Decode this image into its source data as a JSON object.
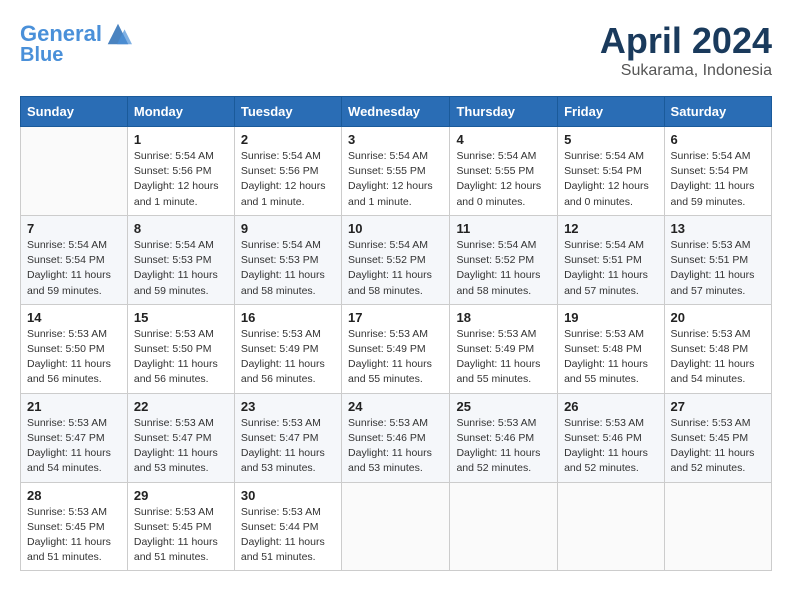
{
  "header": {
    "logo_line1": "General",
    "logo_line2": "Blue",
    "month": "April 2024",
    "location": "Sukarama, Indonesia"
  },
  "weekdays": [
    "Sunday",
    "Monday",
    "Tuesday",
    "Wednesday",
    "Thursday",
    "Friday",
    "Saturday"
  ],
  "weeks": [
    [
      {
        "day": "",
        "info": ""
      },
      {
        "day": "1",
        "info": "Sunrise: 5:54 AM\nSunset: 5:56 PM\nDaylight: 12 hours\nand 1 minute."
      },
      {
        "day": "2",
        "info": "Sunrise: 5:54 AM\nSunset: 5:56 PM\nDaylight: 12 hours\nand 1 minute."
      },
      {
        "day": "3",
        "info": "Sunrise: 5:54 AM\nSunset: 5:55 PM\nDaylight: 12 hours\nand 1 minute."
      },
      {
        "day": "4",
        "info": "Sunrise: 5:54 AM\nSunset: 5:55 PM\nDaylight: 12 hours\nand 0 minutes."
      },
      {
        "day": "5",
        "info": "Sunrise: 5:54 AM\nSunset: 5:54 PM\nDaylight: 12 hours\nand 0 minutes."
      },
      {
        "day": "6",
        "info": "Sunrise: 5:54 AM\nSunset: 5:54 PM\nDaylight: 11 hours\nand 59 minutes."
      }
    ],
    [
      {
        "day": "7",
        "info": "Sunrise: 5:54 AM\nSunset: 5:54 PM\nDaylight: 11 hours\nand 59 minutes."
      },
      {
        "day": "8",
        "info": "Sunrise: 5:54 AM\nSunset: 5:53 PM\nDaylight: 11 hours\nand 59 minutes."
      },
      {
        "day": "9",
        "info": "Sunrise: 5:54 AM\nSunset: 5:53 PM\nDaylight: 11 hours\nand 58 minutes."
      },
      {
        "day": "10",
        "info": "Sunrise: 5:54 AM\nSunset: 5:52 PM\nDaylight: 11 hours\nand 58 minutes."
      },
      {
        "day": "11",
        "info": "Sunrise: 5:54 AM\nSunset: 5:52 PM\nDaylight: 11 hours\nand 58 minutes."
      },
      {
        "day": "12",
        "info": "Sunrise: 5:54 AM\nSunset: 5:51 PM\nDaylight: 11 hours\nand 57 minutes."
      },
      {
        "day": "13",
        "info": "Sunrise: 5:53 AM\nSunset: 5:51 PM\nDaylight: 11 hours\nand 57 minutes."
      }
    ],
    [
      {
        "day": "14",
        "info": "Sunrise: 5:53 AM\nSunset: 5:50 PM\nDaylight: 11 hours\nand 56 minutes."
      },
      {
        "day": "15",
        "info": "Sunrise: 5:53 AM\nSunset: 5:50 PM\nDaylight: 11 hours\nand 56 minutes."
      },
      {
        "day": "16",
        "info": "Sunrise: 5:53 AM\nSunset: 5:49 PM\nDaylight: 11 hours\nand 56 minutes."
      },
      {
        "day": "17",
        "info": "Sunrise: 5:53 AM\nSunset: 5:49 PM\nDaylight: 11 hours\nand 55 minutes."
      },
      {
        "day": "18",
        "info": "Sunrise: 5:53 AM\nSunset: 5:49 PM\nDaylight: 11 hours\nand 55 minutes."
      },
      {
        "day": "19",
        "info": "Sunrise: 5:53 AM\nSunset: 5:48 PM\nDaylight: 11 hours\nand 55 minutes."
      },
      {
        "day": "20",
        "info": "Sunrise: 5:53 AM\nSunset: 5:48 PM\nDaylight: 11 hours\nand 54 minutes."
      }
    ],
    [
      {
        "day": "21",
        "info": "Sunrise: 5:53 AM\nSunset: 5:47 PM\nDaylight: 11 hours\nand 54 minutes."
      },
      {
        "day": "22",
        "info": "Sunrise: 5:53 AM\nSunset: 5:47 PM\nDaylight: 11 hours\nand 53 minutes."
      },
      {
        "day": "23",
        "info": "Sunrise: 5:53 AM\nSunset: 5:47 PM\nDaylight: 11 hours\nand 53 minutes."
      },
      {
        "day": "24",
        "info": "Sunrise: 5:53 AM\nSunset: 5:46 PM\nDaylight: 11 hours\nand 53 minutes."
      },
      {
        "day": "25",
        "info": "Sunrise: 5:53 AM\nSunset: 5:46 PM\nDaylight: 11 hours\nand 52 minutes."
      },
      {
        "day": "26",
        "info": "Sunrise: 5:53 AM\nSunset: 5:46 PM\nDaylight: 11 hours\nand 52 minutes."
      },
      {
        "day": "27",
        "info": "Sunrise: 5:53 AM\nSunset: 5:45 PM\nDaylight: 11 hours\nand 52 minutes."
      }
    ],
    [
      {
        "day": "28",
        "info": "Sunrise: 5:53 AM\nSunset: 5:45 PM\nDaylight: 11 hours\nand 51 minutes."
      },
      {
        "day": "29",
        "info": "Sunrise: 5:53 AM\nSunset: 5:45 PM\nDaylight: 11 hours\nand 51 minutes."
      },
      {
        "day": "30",
        "info": "Sunrise: 5:53 AM\nSunset: 5:44 PM\nDaylight: 11 hours\nand 51 minutes."
      },
      {
        "day": "",
        "info": ""
      },
      {
        "day": "",
        "info": ""
      },
      {
        "day": "",
        "info": ""
      },
      {
        "day": "",
        "info": ""
      }
    ]
  ]
}
